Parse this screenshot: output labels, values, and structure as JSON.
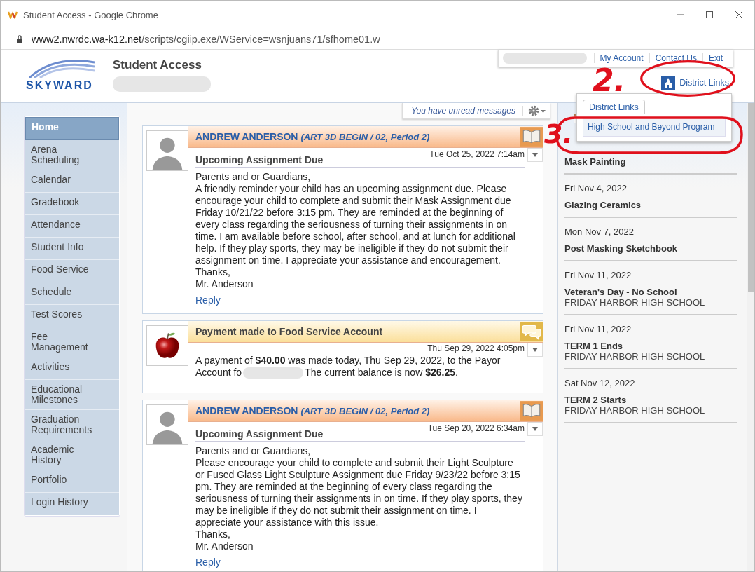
{
  "window": {
    "title": "Student Access - Google Chrome",
    "url_host": "www2.nwrdc.wa-k12.net",
    "url_path": "/scripts/cgiip.exe/WService=wsnjuans71/sfhome01.w"
  },
  "header": {
    "logo_text": "SKYWARD",
    "title": "Student Access",
    "links": [
      "My Account",
      "Contact Us",
      "Exit"
    ],
    "district_button": "District Links"
  },
  "toolbar": {
    "notice": "You have unread messages"
  },
  "sidebar": {
    "items": [
      {
        "label": "Home",
        "selected": true
      },
      {
        "label": "Arena Scheduling",
        "selected": false
      },
      {
        "label": "Calendar",
        "selected": false
      },
      {
        "label": "Gradebook",
        "selected": false
      },
      {
        "label": "Attendance",
        "selected": false
      },
      {
        "label": "Student Info",
        "selected": false
      },
      {
        "label": "Food Service",
        "selected": false
      },
      {
        "label": "Schedule",
        "selected": false
      },
      {
        "label": "Test Scores",
        "selected": false
      },
      {
        "label": "Fee Management",
        "selected": false
      },
      {
        "label": "Activities",
        "selected": false
      },
      {
        "label": "Educational Milestones",
        "selected": false
      },
      {
        "label": "Graduation Requirements",
        "selected": false
      },
      {
        "label": "Academic History",
        "selected": false
      },
      {
        "label": "Portfolio",
        "selected": false
      },
      {
        "label": "Login History",
        "selected": false
      }
    ]
  },
  "messages": [
    {
      "kind": "teacher",
      "sender": "ANDREW ANDERSON",
      "course": "(ART 3D BEGIN / 02, Period 2)",
      "date": "Tue Oct 25, 2022 7:14am",
      "subject": "Upcoming Assignment Due",
      "lines": [
        "Parents and or Guardians,",
        "A friendly reminder your child has an upcoming assignment due. Please encourage your child to complete and submit their Mask Assignment due Friday 10/21/22 before 3:15 pm. They are reminded at the beginning of every class regarding the seriousness of turning their assignments in on time. I am available before school, after school, and at lunch for additional help. If they play sports, they may be ineligible if they do not submit their assignment on time. I appreciate your assistance and encouragement.",
        "Thanks,",
        "Mr. Anderson"
      ],
      "reply": "Reply"
    },
    {
      "kind": "payment",
      "subject": "Payment made to Food Service Account",
      "date": "Thu Sep 29, 2022 4:05pm",
      "body_before": "A payment of **$40.00** was made today, Thu Sep 29, 2022, to the Payor Account fo",
      "body_after": "The current balance is now **$26.25**."
    },
    {
      "kind": "teacher",
      "sender": "ANDREW ANDERSON",
      "course": "(ART 3D BEGIN / 02, Period 2)",
      "date": "Tue Sep 20, 2022 6:34am",
      "subject": "Upcoming Assignment Due",
      "lines": [
        "Parents and or Guardians,",
        "Please encourage your child to complete and submit their Light Sculpture or Fused Glass Light Sculpture Assignment due Friday 9/23/22 before 3:15 pm. They are reminded at the beginning of every class regarding the seriousness of turning their assignments in on time. If they play sports, they may be ineligible if they do not submit their assignment on time. I appreciate your assistance with this issue.",
        "Thanks,",
        "Mr. Anderson"
      ],
      "reply": "Reply"
    }
  ],
  "events": [
    {
      "title": "Mask Painting"
    },
    {
      "date": "Fri Nov 4, 2022",
      "title": "Glazing Ceramics"
    },
    {
      "date": "Mon Nov 7, 2022",
      "title": "Post Masking Sketchbook"
    },
    {
      "date": "Fri Nov 11, 2022",
      "title": "Veteran's Day - No School",
      "school": "FRIDAY HARBOR HIGH SCHOOL"
    },
    {
      "date": "Fri Nov 11, 2022",
      "title": "TERM 1 Ends",
      "school": "FRIDAY HARBOR HIGH SCHOOL"
    },
    {
      "date": "Sat Nov 12, 2022",
      "title": "TERM 2 Starts",
      "school": "FRIDAY HARBOR HIGH SCHOOL"
    }
  ],
  "dropdown": {
    "tab": "District Links",
    "items": [
      "High School and Beyond Program"
    ]
  },
  "annotations": [
    "2.",
    "3."
  ]
}
